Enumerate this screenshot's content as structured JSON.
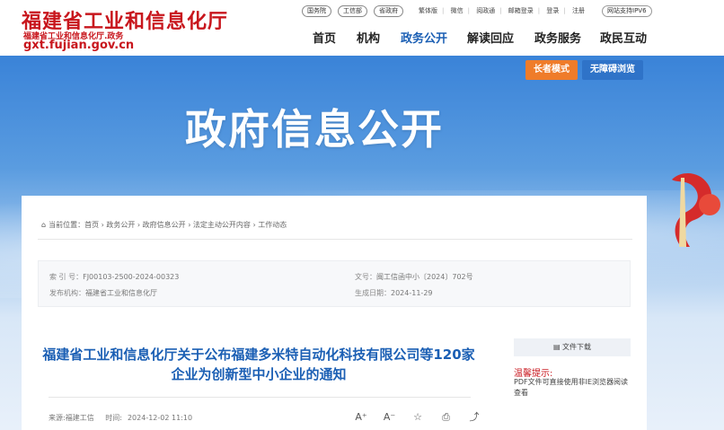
{
  "logo": {
    "title": "福建省工业和信息化厅",
    "subtitle": "福建省工业和信息化厅.政务",
    "domain": "gxt.fujian.gov.cn"
  },
  "top_pills": [
    "国务院",
    "工信部",
    "省政府"
  ],
  "top_links": [
    "繁体版",
    "微信",
    "阅政通",
    "邮箱登录",
    "登录",
    "注册"
  ],
  "ipv6": "网站支持IPV6",
  "nav": [
    "首页",
    "机构",
    "政务公开",
    "解读回应",
    "政务服务",
    "政民互动"
  ],
  "banner": {
    "title": "政府信息公开",
    "elder_mode": "长者模式",
    "accessible": "无障碍浏览"
  },
  "breadcrumb": {
    "label": "当前位置：",
    "path": "首页 › 政务公开 › 政府信息公开 › 法定主动公开内容 › 工作动态"
  },
  "meta": {
    "index_label": "索 引 号：",
    "index_value": "FJ00103-2500-2024-00323",
    "doc_label": "文号：",
    "doc_value": "闽工信函中小〔2024〕702号",
    "publisher_label": "发布机构：",
    "publisher_value": "福建省工业和信息化厅",
    "date_label": "生成日期：",
    "date_value": "2024-11-29"
  },
  "article": {
    "title": "福建省工业和信息化厅关于公布福建多米特自动化科技有限公司等120家企业为创新型中小企业的通知",
    "source_label": "来源:",
    "source": "福建工信",
    "time_label": "时间:",
    "time": "2024-12-02 11:10",
    "tools": [
      "A⁺",
      "A⁻",
      "☆",
      "⎙",
      "⤴"
    ]
  },
  "sidebar": {
    "download": "文件下载",
    "tip_heading": "温馨提示:",
    "tip_body": "PDF文件可直接使用非IE浏览器阅读查看"
  },
  "colors": {
    "brand_red": "#c8161d",
    "nav_blue": "#1b5fb4",
    "elder_orange": "#ef7c2a"
  }
}
